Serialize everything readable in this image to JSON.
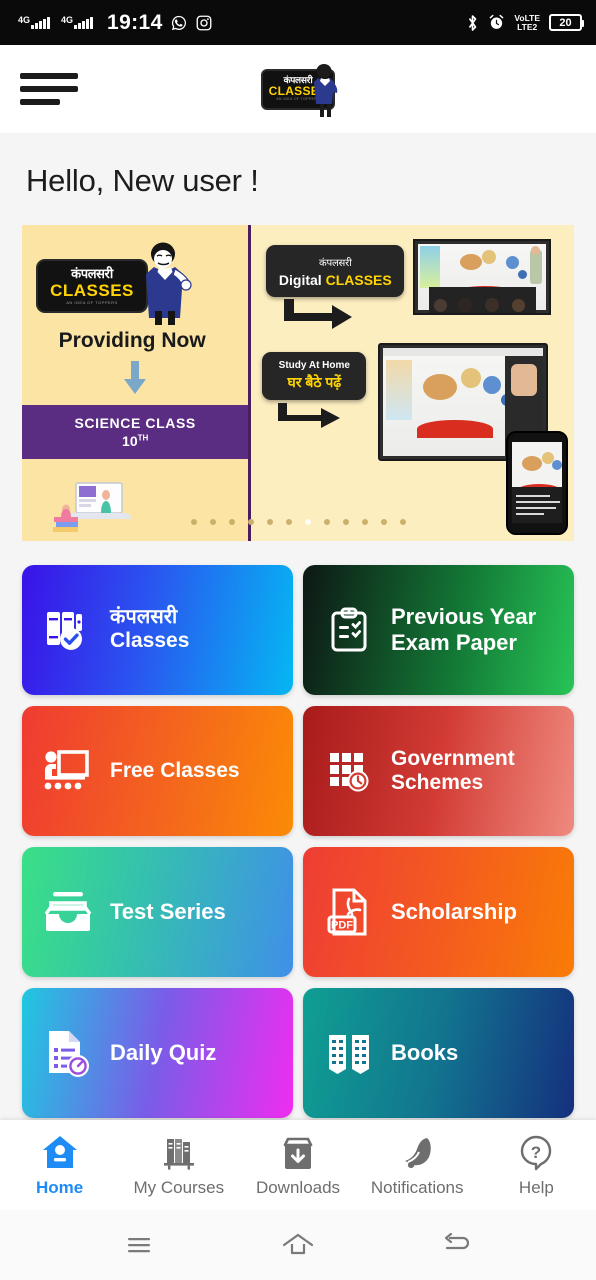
{
  "status_bar": {
    "network_1": "4G",
    "network_2": "4G",
    "time": "19:14",
    "app_icons": [
      "whatsapp-icon",
      "instagram-icon"
    ],
    "right_icons": [
      "bluetooth-icon",
      "alarm-icon"
    ],
    "volte_line1": "VoLTE",
    "volte_line2": "LTE2",
    "battery_level": "20"
  },
  "header": {
    "menu_icon": "hamburger-menu-icon",
    "logo": {
      "hindi": "कंपलसरी",
      "english": "CLASSES",
      "tagline": "AN IDEA OF TOPPERS"
    }
  },
  "greeting": "Hello, New user !",
  "banner": {
    "left": {
      "logo_hindi": "कंपलसरी",
      "logo_english": "CLASSES",
      "logo_tagline": "AN IDEA OF TOPPERS",
      "headline": "Providing Now",
      "subject_line1": "SCIENCE CLASS",
      "subject_line2": "10",
      "subject_sup": "TH"
    },
    "right": {
      "tag1_line1": "कंपलसरी",
      "tag1_line2_plain": "Digital ",
      "tag1_line2_accent": "CLASSES",
      "tag2_line1": "Study At Home",
      "tag2_line2": "घर बैठे पढ़ें"
    },
    "dots_total": 12,
    "dots_active_index": 6
  },
  "tiles": [
    {
      "name": "compulsory-classes",
      "hindi": "कंपलसरी",
      "english": "Classes",
      "icon": "books-check-icon",
      "theme": "t1"
    },
    {
      "name": "previous-year-exam-paper",
      "english": "Previous Year Exam Paper",
      "icon": "clipboard-list-icon",
      "theme": "t2"
    },
    {
      "name": "free-classes",
      "english": "Free Classes",
      "icon": "classroom-teaching-icon",
      "theme": "t3"
    },
    {
      "name": "government-schemes",
      "english": "Government Schemes",
      "icon": "calendar-clock-icon",
      "theme": "t4"
    },
    {
      "name": "test-series",
      "english": "Test Series",
      "icon": "inbox-tray-icon",
      "theme": "t5"
    },
    {
      "name": "scholarship",
      "english": "Scholarship",
      "icon": "pdf-file-icon",
      "theme": "t6"
    },
    {
      "name": "daily-quiz",
      "english": "Daily Quiz",
      "icon": "document-timer-icon",
      "theme": "t7"
    },
    {
      "name": "books",
      "english": "Books",
      "icon": "open-book-icon",
      "theme": "t8"
    }
  ],
  "bottom_nav": [
    {
      "label": "Home",
      "icon": "home-icon",
      "active": true
    },
    {
      "label": "My Courses",
      "icon": "books-shelf-icon",
      "active": false
    },
    {
      "label": "Downloads",
      "icon": "download-box-icon",
      "active": false
    },
    {
      "label": "Notifications",
      "icon": "bell-icon",
      "active": false
    },
    {
      "label": "Help",
      "icon": "question-mark-icon",
      "active": false
    }
  ],
  "system_nav": [
    {
      "name": "recents-button",
      "icon": "recents-icon"
    },
    {
      "name": "home-button",
      "icon": "home-outline-icon"
    },
    {
      "name": "back-button",
      "icon": "back-arrow-icon"
    }
  ],
  "colors": {
    "accent": "#1f8cf5",
    "banner_bg": "#fbe4a4",
    "purple": "#5b2d82",
    "page_bg": "#f5f5f5"
  }
}
